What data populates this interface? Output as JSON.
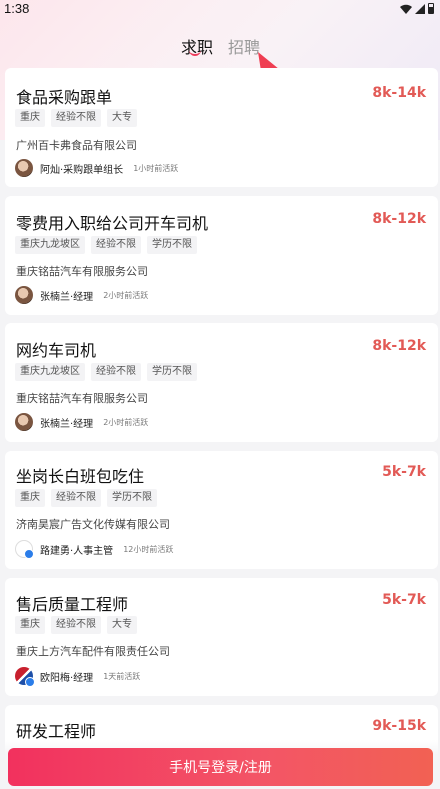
{
  "status_bar": {
    "time": "1:38"
  },
  "tabs": {
    "active": "求职",
    "inactive": "招聘"
  },
  "jobs": [
    {
      "title": "食品采购跟单",
      "salary": "8k-14k",
      "tags": [
        "重庆",
        "经验不限",
        "大专"
      ],
      "company": "广州百卡弗食品有限公司",
      "recruiter": "阿灿·采购跟单组长",
      "active": "1小时前活跃"
    },
    {
      "title": "零费用入职给公司开车司机",
      "salary": "8k-12k",
      "tags": [
        "重庆九龙坡区",
        "经验不限",
        "学历不限"
      ],
      "company": "重庆铭喆汽车有限服务公司",
      "recruiter": "张楠兰·经理",
      "active": "2小时前活跃"
    },
    {
      "title": "网约车司机",
      "salary": "8k-12k",
      "tags": [
        "重庆九龙坡区",
        "经验不限",
        "学历不限"
      ],
      "company": "重庆铭喆汽车有限服务公司",
      "recruiter": "张楠兰·经理",
      "active": "2小时前活跃"
    },
    {
      "title": "坐岗长白班包吃住",
      "salary": "5k-7k",
      "tags": [
        "重庆",
        "经验不限",
        "学历不限"
      ],
      "company": "济南昊宸广告文化传媒有限公司",
      "recruiter": "路建勇·人事主管",
      "active": "12小时前活跃"
    },
    {
      "title": "售后质量工程师",
      "salary": "5k-7k",
      "tags": [
        "重庆",
        "经验不限",
        "大专"
      ],
      "company": "重庆上方汽车配件有限责任公司",
      "recruiter": "欧阳梅·经理",
      "active": "1天前活跃"
    },
    {
      "title": "研发工程师",
      "salary": "9k-15k"
    }
  ],
  "login": {
    "label": "手机号登录/注册"
  }
}
